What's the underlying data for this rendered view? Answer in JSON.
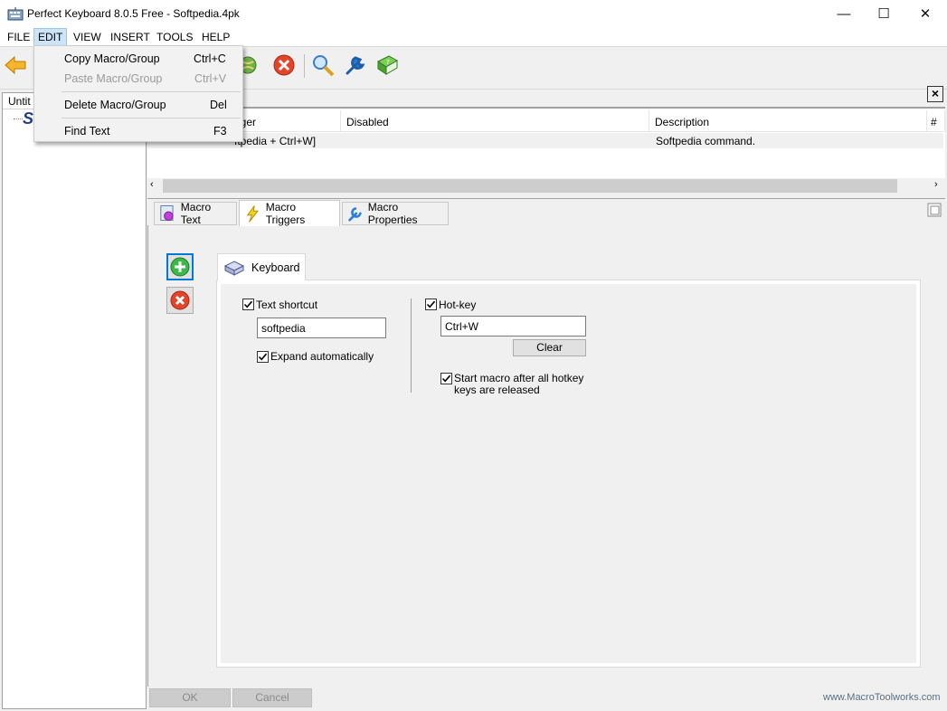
{
  "window": {
    "title": "Perfect Keyboard 8.0.5 Free - Softpedia.4pk",
    "minimize": "—",
    "maximize": "☐",
    "close": "✕"
  },
  "menu": [
    {
      "label": "FILE"
    },
    {
      "label": "EDIT",
      "active": true
    },
    {
      "label": "VIEW"
    },
    {
      "label": "INSERT"
    },
    {
      "label": "TOOLS"
    },
    {
      "label": "HELP"
    }
  ],
  "edit_menu": {
    "items": [
      {
        "label": "Copy Macro/Group",
        "shortcut": "Ctrl+C",
        "enabled": true
      },
      {
        "label": "Paste Macro/Group",
        "shortcut": "Ctrl+V",
        "enabled": false
      },
      {
        "label": "Delete Macro/Group",
        "shortcut": "Del",
        "enabled": true
      },
      {
        "label": "Find Text",
        "shortcut": "F3",
        "enabled": true
      }
    ]
  },
  "toolbar": {
    "icons": [
      "back-arrow-icon",
      "globe-icon",
      "delete-icon",
      "search-icon",
      "wrench-icon",
      "help-book-icon"
    ]
  },
  "left_panel": {
    "header": "Untit",
    "tree_node": "S"
  },
  "list": {
    "columns": [
      "gger",
      "Disabled",
      "Description",
      "#"
    ],
    "row": {
      "trigger": "ftpedia + Ctrl+W]",
      "disabled": "",
      "description": "Softpedia command.",
      "num": ""
    }
  },
  "tabs": [
    {
      "label": "Macro Text",
      "selected": false
    },
    {
      "label": "Macro Triggers",
      "selected": true
    },
    {
      "label": "Macro Properties",
      "selected": false
    }
  ],
  "triggers": {
    "group_tab": "Keyboard",
    "text_shortcut": {
      "label": "Text shortcut",
      "checked": true,
      "value": "softpedia"
    },
    "expand_automatically": {
      "label": "Expand automatically",
      "checked": true
    },
    "hotkey": {
      "label": "Hot-key",
      "checked": true,
      "value": "Ctrl+W",
      "clear_label": "Clear"
    },
    "start_after_release": {
      "label_line1": "Start macro after all hotkey",
      "label_line2": "keys are released",
      "checked": true
    }
  },
  "footer": {
    "ok": "OK",
    "cancel": "Cancel",
    "link": "www.MacroToolworks.com"
  },
  "colors": {
    "accent_blue": "#0078d7",
    "menu_highlight": "#cce4f7",
    "delete_red": "#e2452a",
    "add_green": "#3cb84a"
  }
}
